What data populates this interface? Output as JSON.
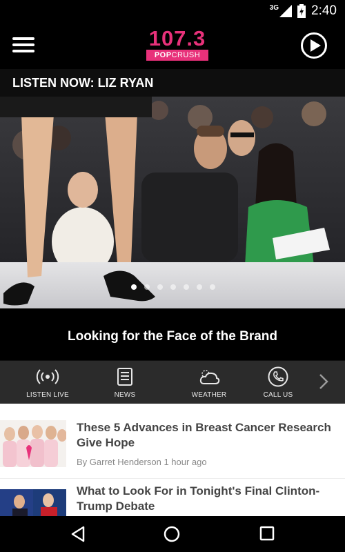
{
  "status_bar": {
    "network": "3G",
    "time": "2:40"
  },
  "app_bar": {
    "logo_number": "107.3",
    "logo_sub_bold": "POP",
    "logo_sub_light": "CRUSH"
  },
  "listen_banner": "LISTEN NOW: LIZ RYAN",
  "hero": {
    "caption": "Looking for the Face of the Brand",
    "slide_count": 7,
    "active_slide": 1
  },
  "quick_nav": {
    "items": [
      {
        "label": "LISTEN LIVE",
        "icon": "broadcast-icon"
      },
      {
        "label": "NEWS",
        "icon": "news-icon"
      },
      {
        "label": "WEATHER",
        "icon": "weather-icon"
      },
      {
        "label": "CALL US",
        "icon": "phone-icon"
      }
    ]
  },
  "feed": {
    "articles": [
      {
        "title": "These 5 Advances in Breast Cancer Research Give Hope",
        "meta": "By Garret Henderson 1 hour ago"
      },
      {
        "title": "What to Look For in Tonight's Final Clinton-Trump Debate"
      }
    ]
  },
  "colors": {
    "brand_pink": "#e8317a",
    "background": "#000000",
    "nav_gray": "#2b2b2b"
  }
}
